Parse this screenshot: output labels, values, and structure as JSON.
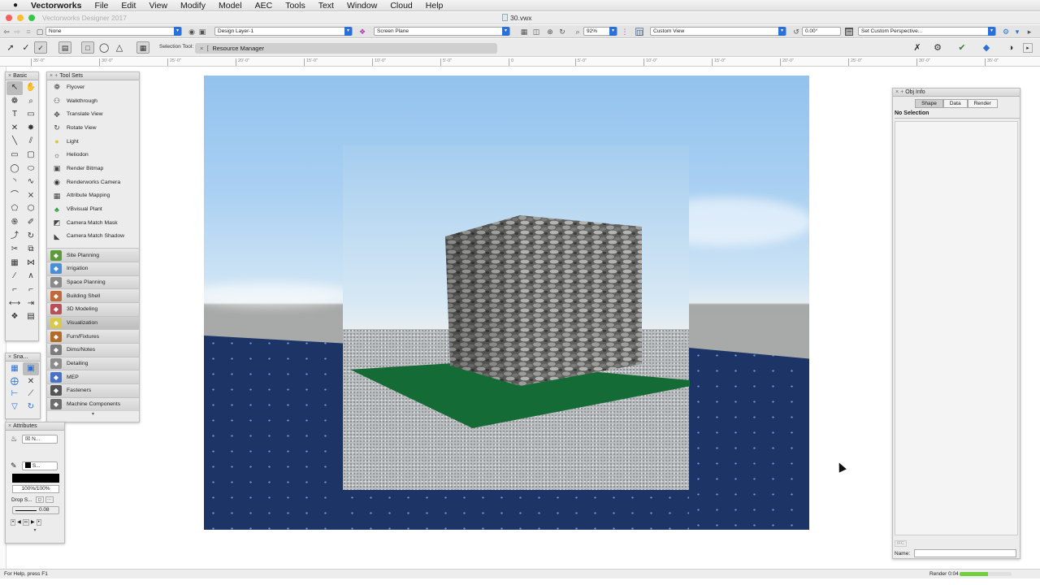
{
  "menubar": {
    "apple_icon": "apple-icon",
    "items": [
      "Vectorworks",
      "File",
      "Edit",
      "View",
      "Modify",
      "Model",
      "AEC",
      "Tools",
      "Text",
      "Window",
      "Cloud",
      "Help"
    ]
  },
  "window": {
    "app_title": "Vectorworks Designer 2017",
    "document_title": "30.vwx",
    "traffic_colors": [
      "#fc5f57",
      "#fdbc2e",
      "#33c748"
    ]
  },
  "viewbar": {
    "class_value": "None",
    "layer_value": "Design Layer-1",
    "plane_value": "Screen Plane",
    "zoom_value": "92%",
    "view_value": "Custom View",
    "rotation_value": "0.00°",
    "perspective_value": "Set Custom Perspective..."
  },
  "toolbar": {
    "selection_tool_label": "Selection Tool:",
    "resource_manager_label": "Resource Manager"
  },
  "ruler": {
    "ticks": [
      "35'-0\"",
      "30'-0\"",
      "25'-0\"",
      "20'-0\"",
      "15'-0\"",
      "10'-0\"",
      "5'-0\"",
      "0",
      "5'-0\"",
      "10'-0\"",
      "15'-0\"",
      "20'-0\"",
      "25'-0\"",
      "30'-0\"",
      "35'-0\""
    ]
  },
  "basic_palette": {
    "title": "Basic",
    "tools": [
      "selection-arrow-icon",
      "pan-hand-icon",
      "flyover-icon",
      "zoom-icon",
      "text-icon",
      "callout-icon",
      "locus-icon",
      "3d-locus-icon",
      "line-icon",
      "double-line-icon",
      "rectangle-icon",
      "rounded-rect-icon",
      "circle-icon",
      "oval-icon",
      "arc-icon",
      "freehand-icon",
      "polyline-icon",
      "double-polyline-icon",
      "polygon-icon",
      "regular-polygon-icon",
      "spiral-icon",
      "eyedropper-icon",
      "reshape-icon",
      "rotate-icon",
      "clip-icon",
      "offset-icon",
      "attribute-mapping-icon",
      "mirror-icon",
      "split-icon",
      "connect-combine-icon",
      "fillet-icon",
      "chamfer-icon",
      "dimension-icon",
      "constrained-dim-icon",
      "layer-link-icon",
      "viewport-icon"
    ]
  },
  "tool_sets": {
    "title": "Tool Sets",
    "tools": [
      {
        "label": "Flyover",
        "icon": "flyover-icon"
      },
      {
        "label": "Walkthrough",
        "icon": "walkthrough-icon"
      },
      {
        "label": "Translate View",
        "icon": "translate-view-icon"
      },
      {
        "label": "Rotate View",
        "icon": "rotate-view-icon"
      },
      {
        "label": "Light",
        "icon": "light-bulb-icon"
      },
      {
        "label": "Heliodon",
        "icon": "heliodon-icon"
      },
      {
        "label": "Render Bitmap",
        "icon": "render-bitmap-icon"
      },
      {
        "label": "Renderworks Camera",
        "icon": "camera-icon"
      },
      {
        "label": "Attribute Mapping",
        "icon": "attribute-mapping-icon"
      },
      {
        "label": "VBvisual Plant",
        "icon": "plant-icon"
      },
      {
        "label": "Camera Match Mask",
        "icon": "camera-match-mask-icon"
      },
      {
        "label": "Camera Match Shadow",
        "icon": "camera-match-shadow-icon"
      }
    ],
    "sets": [
      {
        "label": "Site Planning",
        "icon": "site-planning-icon",
        "color": "#5c9a3a"
      },
      {
        "label": "Irrigation",
        "icon": "irrigation-icon",
        "color": "#4a8fd6"
      },
      {
        "label": "Space Planning",
        "icon": "space-planning-icon",
        "color": "#8a8a8a"
      },
      {
        "label": "Building Shell",
        "icon": "building-shell-icon",
        "color": "#c06a3a"
      },
      {
        "label": "3D Modeling",
        "icon": "3d-modeling-icon",
        "color": "#b8505a"
      },
      {
        "label": "Visualization",
        "icon": "visualization-icon",
        "color": "#d9c94a"
      },
      {
        "label": "Furn/Fixtures",
        "icon": "furniture-icon",
        "color": "#b36b2a"
      },
      {
        "label": "Dims/Notes",
        "icon": "dims-notes-icon",
        "color": "#7c7c7c"
      },
      {
        "label": "Detailing",
        "icon": "detailing-icon",
        "color": "#8d8d8d"
      },
      {
        "label": "MEP",
        "icon": "mep-icon",
        "color": "#4a72c4"
      },
      {
        "label": "Fasteners",
        "icon": "fasteners-icon",
        "color": "#555555"
      },
      {
        "label": "Machine Components",
        "icon": "machine-components-icon",
        "color": "#6e6e6e"
      }
    ],
    "active_set": "Visualization"
  },
  "snap_palette": {
    "title": "Sna..."
  },
  "attributes_palette": {
    "title": "Attributes",
    "fill_value": "N...",
    "pen_value": "S...",
    "opacity_value": "100%/100%",
    "drop_shadow_label": "Drop S...",
    "line_weight_value": "0.08"
  },
  "obj_info": {
    "title": "Obj Info",
    "tabs": [
      "Shape",
      "Data",
      "Render"
    ],
    "active_tab": "Shape",
    "selection_text": "No Selection",
    "ifc_label": "IFC",
    "name_label": "Name:"
  },
  "status": {
    "help_text": "For Help, press F1",
    "render_text": "Render 0:04",
    "render_progress": 0.55,
    "render_color": "#6fcf3c"
  }
}
